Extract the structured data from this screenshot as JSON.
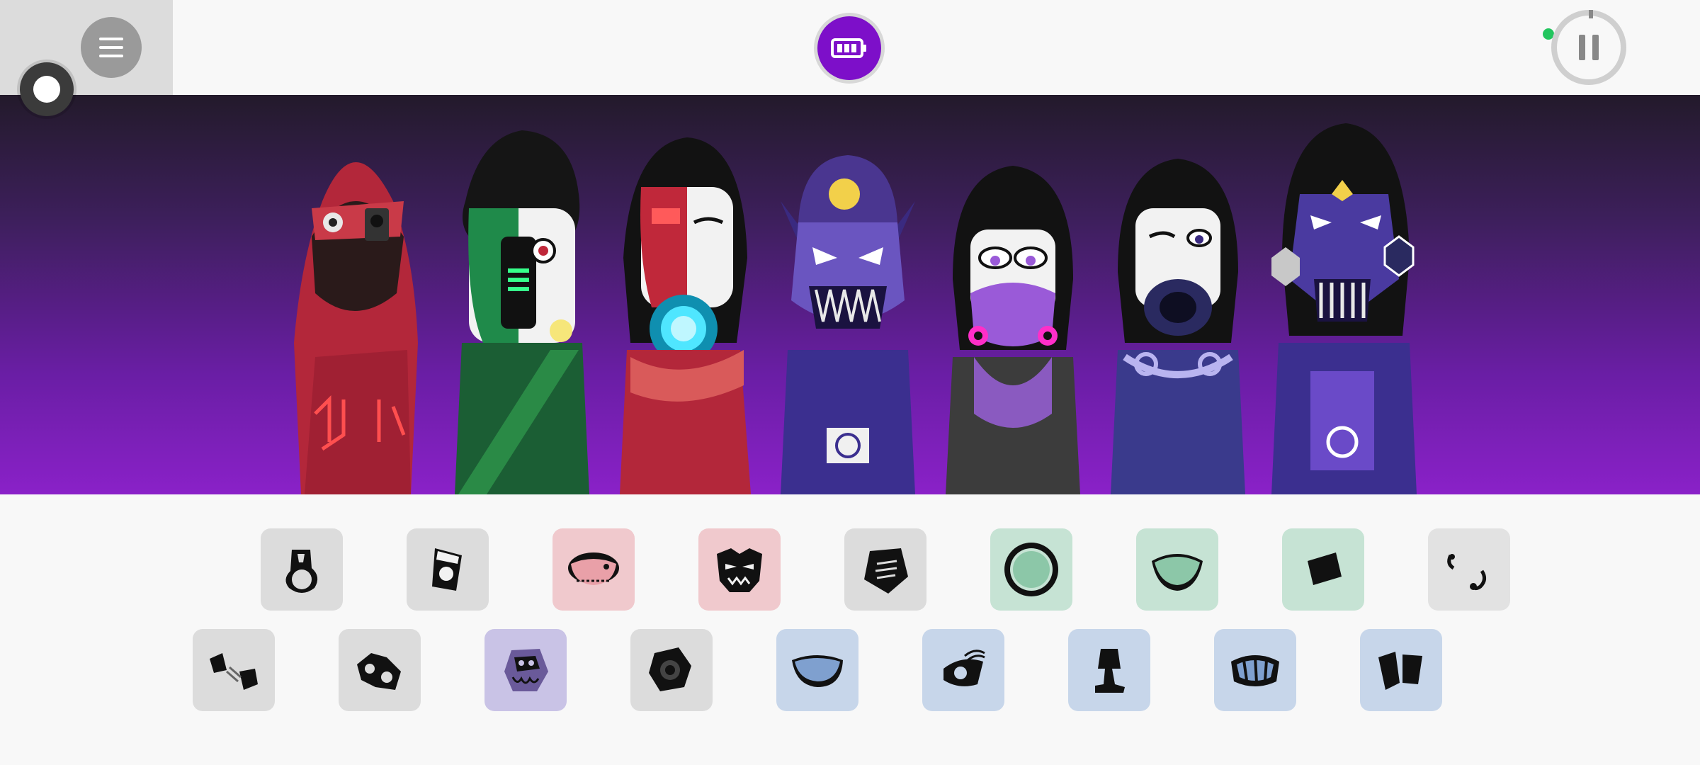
{
  "top_bar": {
    "menu_icon": "hamburger-menu-icon",
    "record_icon": "record-toggle-icon",
    "center_icon": "battery-bonus-icon",
    "pause_icon": "pause-icon",
    "status_color": "#22c55e",
    "accent_color": "#7d0fc9"
  },
  "stage": {
    "characters": [
      {
        "name": "red-hooded-character",
        "color": "#b3273a"
      },
      {
        "name": "green-masked-character",
        "color": "#1f7a45"
      },
      {
        "name": "red-cyborg-character",
        "color": "#c0283a"
      },
      {
        "name": "purple-skull-cap-character",
        "color": "#5b3ea8"
      },
      {
        "name": "gasmask-character",
        "color": "#4a4a4a"
      },
      {
        "name": "purple-mask-character",
        "color": "#3a3a8c"
      },
      {
        "name": "hex-robot-character",
        "color": "#3b2f8f"
      }
    ]
  },
  "sound_icons": {
    "row1": [
      {
        "name": "beat-icon-1",
        "category": "beats",
        "bg": "#dcdcdc"
      },
      {
        "name": "beat-icon-2",
        "category": "beats",
        "bg": "#dcdcdc"
      },
      {
        "name": "effect-icon-1",
        "category": "effects",
        "bg": "#f0c9cd"
      },
      {
        "name": "effect-icon-2",
        "category": "effects",
        "bg": "#f0c9cd"
      },
      {
        "name": "effect-icon-3",
        "category": "effects",
        "bg": "#dcdcdc"
      },
      {
        "name": "melody-icon-1",
        "category": "melodies",
        "bg": "#c6e3d4"
      },
      {
        "name": "melody-icon-2",
        "category": "melodies",
        "bg": "#c6e3d4"
      },
      {
        "name": "melody-icon-3",
        "category": "melodies",
        "bg": "#c6e3d4"
      },
      {
        "name": "melody-icon-4",
        "category": "melodies",
        "bg": "#e2e2e2"
      }
    ],
    "row2": [
      {
        "name": "beat-icon-3",
        "category": "beats",
        "bg": "#dcdcdc"
      },
      {
        "name": "beat-icon-4",
        "category": "beats",
        "bg": "#dcdcdc"
      },
      {
        "name": "effect-icon-4",
        "category": "effects",
        "bg": "#c9c3e6"
      },
      {
        "name": "effect-icon-5",
        "category": "effects",
        "bg": "#dcdcdc"
      },
      {
        "name": "voice-icon-1",
        "category": "voices",
        "bg": "#c7d6ea"
      },
      {
        "name": "voice-icon-2",
        "category": "voices",
        "bg": "#c7d6ea"
      },
      {
        "name": "voice-icon-3",
        "category": "voices",
        "bg": "#c7d6ea"
      },
      {
        "name": "voice-icon-4",
        "category": "voices",
        "bg": "#c7d6ea"
      },
      {
        "name": "voice-icon-5",
        "category": "voices",
        "bg": "#c7d6ea"
      }
    ]
  }
}
